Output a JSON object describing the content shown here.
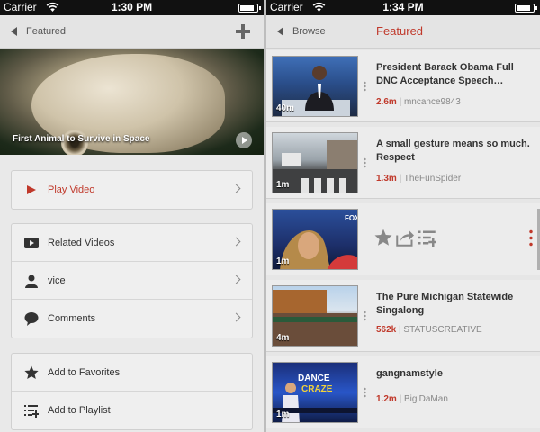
{
  "left_screen": {
    "status": {
      "carrier": "Carrier",
      "time": "1:30 PM",
      "battery_percent": 85
    },
    "nav": {
      "back_label": "Featured"
    },
    "hero": {
      "caption": "First Animal to Survive in Space"
    },
    "menu": {
      "play_video": "Play Video",
      "related_videos": "Related Videos",
      "channel": "vice",
      "comments": "Comments",
      "add_to_favorites": "Add to Favorites",
      "add_to_playlist": "Add to Playlist"
    }
  },
  "right_screen": {
    "status": {
      "carrier": "Carrier",
      "time": "1:34 PM",
      "battery_percent": 85
    },
    "nav": {
      "back_label": "Browse",
      "title": "Featured"
    },
    "videos": [
      {
        "title": "President Barack Obama Full DNC Acceptance Speech…",
        "views": "2.6m",
        "separator": "|",
        "channel": "mncance9843",
        "duration": "40m"
      },
      {
        "title": "A small gesture means so much. Respect",
        "views": "1.3m",
        "separator": "|",
        "channel": "TheFunSpider",
        "duration": "1m"
      },
      {
        "title": "",
        "views": "",
        "separator": "",
        "channel": "",
        "duration": "1m",
        "actions_open": true
      },
      {
        "title": "The Pure Michigan Statewide Singalong",
        "views": "562k",
        "separator": "|",
        "channel": "STATUSCREATIVE",
        "duration": "4m"
      },
      {
        "title": "gangnamstyle",
        "views": "1.2m",
        "separator": "|",
        "channel": "BigiDaMan",
        "duration": "1m"
      }
    ],
    "thumb_badges": {
      "fox": "FOX",
      "dance": "DANCE",
      "craze": "CRAZE"
    }
  },
  "colors": {
    "accent": "#c0392b",
    "text": "#333333",
    "muted": "#888888"
  }
}
